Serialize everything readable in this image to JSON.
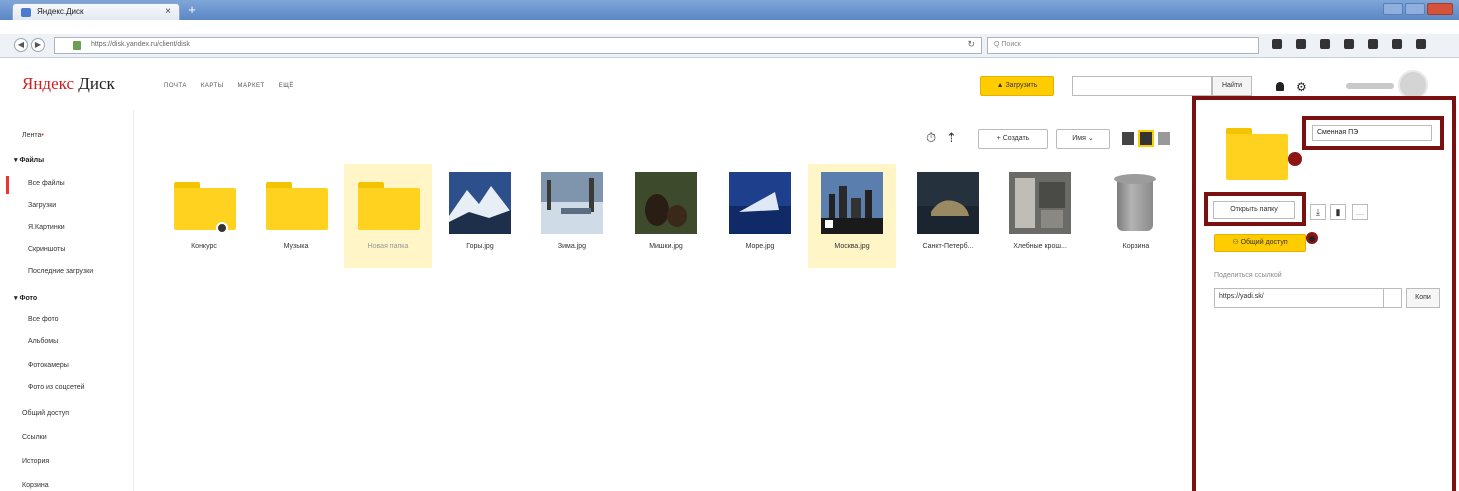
{
  "browser": {
    "tab_title": "Яндекс.Диск",
    "url": "https://disk.yandex.ru/client/disk",
    "search_placeholder": "Q Поиск"
  },
  "header": {
    "logo_red": "Яндекс",
    "logo_black": " Диск",
    "nav": [
      "ПОЧТА",
      "КАРТЫ",
      "МАРКЕТ",
      "ЕЩЁ"
    ],
    "upload_label": "Загрузить",
    "find_label": "Найти"
  },
  "sidebar": {
    "feed": "Лента",
    "files_header": "Файлы",
    "files_items": [
      "Все файлы",
      "Загрузки",
      "Я.Картинки",
      "Скриншоты",
      "Последние загрузки"
    ],
    "photos_header": "Фото",
    "photos_items": [
      "Все фото",
      "Альбомы",
      "Фотокамеры",
      "Фото из соцсетей"
    ],
    "bottom_items": [
      "Общий доступ",
      "Ссылки",
      "История",
      "Корзина"
    ]
  },
  "toolbar": {
    "create_label": "Создать",
    "sort_label": "Имя"
  },
  "files": [
    {
      "label": "Конкурс",
      "kind": "folder"
    },
    {
      "label": "Музыка",
      "kind": "folder"
    },
    {
      "label": "Новая папка",
      "kind": "folder"
    },
    {
      "label": "Горы.jpg",
      "kind": "image"
    },
    {
      "label": "Зима.jpg",
      "kind": "image"
    },
    {
      "label": "Мишки.jpg",
      "kind": "image"
    },
    {
      "label": "Море.jpg",
      "kind": "image"
    },
    {
      "label": "Москва.jpg",
      "kind": "image"
    },
    {
      "label": "Санкт-Петерб...",
      "kind": "image"
    },
    {
      "label": "Хлебные крош...",
      "kind": "image"
    },
    {
      "label": "Корзина",
      "kind": "trash"
    }
  ],
  "panel": {
    "folder_name": "Сменная ПЭ",
    "open_folder_label": "Открыть папку",
    "share_label": "Общий доступ",
    "link_label": "Поделиться ссылкой",
    "link_value": "https://yadi.sk/",
    "copy_label": "Копи"
  },
  "colors": {
    "accent_yellow": "#ffcc00",
    "highlight_border": "#7a1010"
  }
}
